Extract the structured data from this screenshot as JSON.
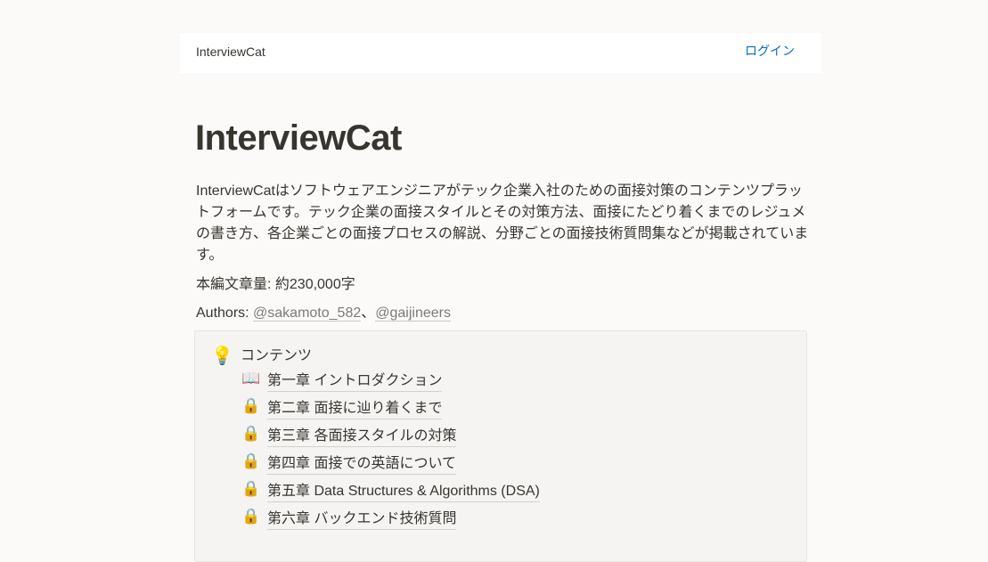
{
  "navbar": {
    "brand": "InterviewCat",
    "login_label": "ログイン"
  },
  "main": {
    "title": "InterviewCat",
    "description": "InterviewCatはソフトウェアエンジニアがテック企業入社のための面接対策のコンテンツプラットフォームです。テック企業の面接スタイルとその対策方法、面接にたどり着くまでのレジュメの書き方、各企業ごとの面接プロセスの解説、分野ごとの面接技術質問集などが掲載されています。",
    "word_count": "本編文章量: 約230,000字",
    "authors_label": "Authors: ",
    "authors": [
      "@sakamoto_582",
      "@gaijineers"
    ],
    "author_separator": "、"
  },
  "contents": {
    "icon": "💡",
    "title": "コンテンツ",
    "chapters": [
      {
        "icon": "📖",
        "label": "第一章 イントロダクション"
      },
      {
        "icon": "🔒",
        "label": "第二章 面接に辿り着くまで"
      },
      {
        "icon": "🔒",
        "label": "第三章 各面接スタイルの対策"
      },
      {
        "icon": "🔒",
        "label": "第四章 面接での英語について"
      },
      {
        "icon": "🔒",
        "label": "第五章 Data Structures & Algorithms (DSA)"
      },
      {
        "icon": "🔒",
        "label": "第六章 バックエンド技術質問"
      }
    ]
  }
}
